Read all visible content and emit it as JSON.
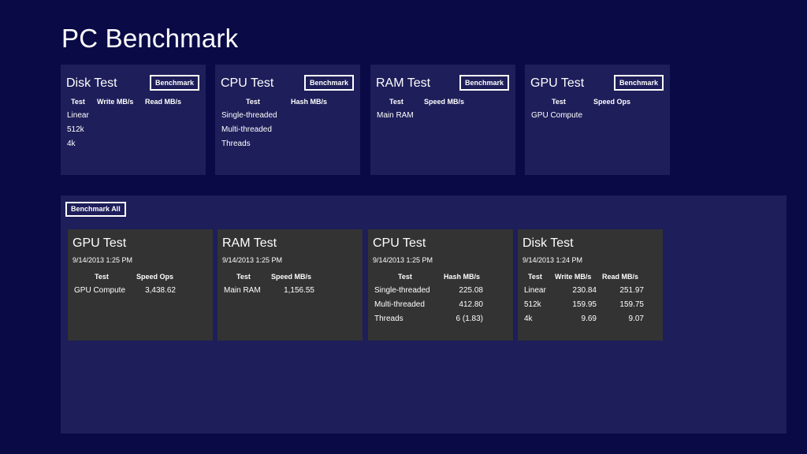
{
  "app": {
    "title": "PC Benchmark"
  },
  "tests": [
    {
      "title": "Disk Test",
      "button": "Benchmark",
      "headers": [
        "Test",
        "Write MB/s",
        "Read MB/s"
      ],
      "rows": [
        "Linear",
        "512k",
        "4k"
      ]
    },
    {
      "title": "CPU Test",
      "button": "Benchmark",
      "headers": [
        "Test",
        "Hash MB/s"
      ],
      "rows": [
        "Single-threaded",
        "Multi-threaded",
        "Threads"
      ]
    },
    {
      "title": "RAM Test",
      "button": "Benchmark",
      "headers": [
        "Test",
        "Speed MB/s"
      ],
      "rows": [
        "Main RAM"
      ]
    },
    {
      "title": "GPU Test",
      "button": "Benchmark",
      "headers": [
        "Test",
        "Speed Ops"
      ],
      "rows": [
        "GPU Compute"
      ]
    }
  ],
  "results": {
    "benchmark_all": "Benchmark All",
    "items": [
      {
        "title": "GPU Test",
        "date": "9/14/2013 1:25 PM",
        "headers": [
          "Test",
          "Speed Ops"
        ],
        "rows": [
          [
            "GPU Compute",
            "3,438.62"
          ]
        ]
      },
      {
        "title": "RAM Test",
        "date": "9/14/2013 1:25 PM",
        "headers": [
          "Test",
          "Speed MB/s"
        ],
        "rows": [
          [
            "Main RAM",
            "1,156.55"
          ]
        ]
      },
      {
        "title": "CPU Test",
        "date": "9/14/2013 1:25 PM",
        "headers": [
          "Test",
          "Hash MB/s"
        ],
        "rows": [
          [
            "Single-threaded",
            "225.08"
          ],
          [
            "Multi-threaded",
            "412.80"
          ],
          [
            "Threads",
            "6 (1.83)"
          ]
        ]
      },
      {
        "title": "Disk Test",
        "date": "9/14/2013 1:24 PM",
        "headers": [
          "Test",
          "Write MB/s",
          "Read MB/s"
        ],
        "rows": [
          [
            "Linear",
            "230.84",
            "251.97"
          ],
          [
            "512k",
            "159.95",
            "159.75"
          ],
          [
            "4k",
            "9.69",
            "9.07"
          ]
        ]
      }
    ]
  },
  "colors": {
    "background": "#0a0a46",
    "panel": "#1e1e5a",
    "result_tile": "#333333",
    "text": "#ffffff"
  }
}
